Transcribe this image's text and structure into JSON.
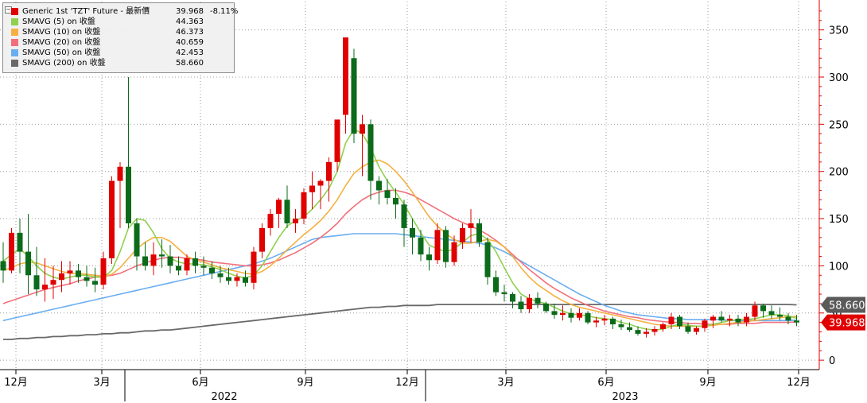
{
  "legend": {
    "rows": [
      {
        "name": "Generic 1st 'TZT' Future - 最新價",
        "value": "39.968",
        "change": "-8.11%",
        "color": "#e00000"
      },
      {
        "name": "SMAVG (5)  on 收盤",
        "value": "44.363",
        "color": "#8fd14f"
      },
      {
        "name": "SMAVG (10)  on 收盤",
        "value": "46.373",
        "color": "#f5b041"
      },
      {
        "name": "SMAVG (20)  on 收盤",
        "value": "40.659",
        "color": "#f1707b"
      },
      {
        "name": "SMAVG (50)  on 收盤",
        "value": "42.453",
        "color": "#6aaef0"
      },
      {
        "name": "SMAVG (200)  on 收盤",
        "value": "58.660",
        "color": "#696969"
      }
    ]
  },
  "chart_data": {
    "type": "candlestick",
    "x_ticks": [
      "12月",
      "3月",
      "6月",
      "9月",
      "12月",
      "3月",
      "6月",
      "9月",
      "12月"
    ],
    "x_groups": [
      "2022",
      "2023"
    ],
    "y_ticks": [
      0,
      50,
      100,
      150,
      200,
      250,
      300,
      350
    ],
    "ylim": [
      -10,
      380
    ],
    "last_price_label": "39.968",
    "sma200_label": "58.660",
    "colors": {
      "up": "#e00000",
      "down": "#0b6b1a",
      "sma5": "#8fd14f",
      "sma10": "#f5b041",
      "sma20": "#f1707b",
      "sma50": "#6aaef0",
      "sma200": "#696969",
      "axis": "#e00000"
    },
    "candles": [
      [
        105,
        125,
        82,
        95
      ],
      [
        95,
        140,
        92,
        135
      ],
      [
        135,
        150,
        92,
        115
      ],
      [
        115,
        155,
        70,
        90
      ],
      [
        90,
        120,
        68,
        75
      ],
      [
        75,
        108,
        62,
        80
      ],
      [
        80,
        100,
        65,
        85
      ],
      [
        85,
        105,
        72,
        92
      ],
      [
        92,
        105,
        80,
        95
      ],
      [
        95,
        102,
        82,
        88
      ],
      [
        88,
        100,
        78,
        84
      ],
      [
        84,
        98,
        72,
        80
      ],
      [
        80,
        115,
        75,
        108
      ],
      [
        108,
        195,
        102,
        190
      ],
      [
        190,
        210,
        140,
        205
      ],
      [
        205,
        300,
        140,
        145
      ],
      [
        145,
        150,
        95,
        110
      ],
      [
        110,
        125,
        95,
        100
      ],
      [
        100,
        125,
        90,
        112
      ],
      [
        112,
        128,
        98,
        110
      ],
      [
        110,
        122,
        92,
        100
      ],
      [
        100,
        110,
        90,
        95
      ],
      [
        95,
        112,
        90,
        108
      ],
      [
        108,
        115,
        92,
        100
      ],
      [
        100,
        110,
        90,
        98
      ],
      [
        98,
        105,
        86,
        92
      ],
      [
        92,
        100,
        82,
        88
      ],
      [
        88,
        98,
        80,
        84
      ],
      [
        84,
        92,
        78,
        88
      ],
      [
        88,
        95,
        78,
        82
      ],
      [
        82,
        120,
        75,
        115
      ],
      [
        115,
        145,
        108,
        140
      ],
      [
        140,
        160,
        132,
        155
      ],
      [
        155,
        172,
        140,
        170
      ],
      [
        170,
        185,
        140,
        145
      ],
      [
        145,
        160,
        135,
        150
      ],
      [
        150,
        182,
        144,
        178
      ],
      [
        178,
        200,
        160,
        185
      ],
      [
        185,
        192,
        160,
        190
      ],
      [
        190,
        215,
        168,
        210
      ],
      [
        210,
        245,
        200,
        255
      ],
      [
        260,
        305,
        240,
        342
      ],
      [
        320,
        330,
        230,
        240
      ],
      [
        240,
        260,
        195,
        250
      ],
      [
        250,
        255,
        170,
        190
      ],
      [
        190,
        195,
        165,
        180
      ],
      [
        180,
        192,
        165,
        172
      ],
      [
        172,
        182,
        150,
        165
      ],
      [
        165,
        170,
        120,
        140
      ],
      [
        140,
        150,
        112,
        130
      ],
      [
        130,
        138,
        105,
        112
      ],
      [
        112,
        120,
        95,
        106
      ],
      [
        106,
        145,
        102,
        138
      ],
      [
        138,
        142,
        98,
        104
      ],
      [
        104,
        132,
        100,
        125
      ],
      [
        125,
        145,
        118,
        140
      ],
      [
        140,
        160,
        125,
        145
      ],
      [
        145,
        150,
        120,
        125
      ],
      [
        125,
        130,
        80,
        88
      ],
      [
        88,
        95,
        68,
        72
      ],
      [
        72,
        80,
        62,
        70
      ],
      [
        70,
        72,
        55,
        62
      ],
      [
        62,
        68,
        50,
        54
      ],
      [
        54,
        70,
        50,
        66
      ],
      [
        66,
        72,
        55,
        60
      ],
      [
        60,
        62,
        50,
        52
      ],
      [
        52,
        60,
        44,
        48
      ],
      [
        48,
        58,
        42,
        50
      ],
      [
        50,
        55,
        40,
        45
      ],
      [
        45,
        55,
        42,
        50
      ],
      [
        50,
        52,
        38,
        40
      ],
      [
        40,
        46,
        35,
        42
      ],
      [
        42,
        48,
        37,
        44
      ],
      [
        44,
        46,
        33,
        38
      ],
      [
        38,
        43,
        32,
        35
      ],
      [
        35,
        40,
        30,
        32
      ],
      [
        32,
        36,
        26,
        28
      ],
      [
        28,
        34,
        24,
        30
      ],
      [
        30,
        36,
        26,
        33
      ],
      [
        33,
        40,
        30,
        38
      ],
      [
        38,
        50,
        33,
        46
      ],
      [
        46,
        48,
        33,
        36
      ],
      [
        36,
        40,
        28,
        30
      ],
      [
        30,
        36,
        27,
        34
      ],
      [
        34,
        44,
        30,
        42
      ],
      [
        42,
        48,
        34,
        46
      ],
      [
        46,
        52,
        40,
        42
      ],
      [
        42,
        48,
        36,
        44
      ],
      [
        44,
        48,
        36,
        40
      ],
      [
        40,
        50,
        36,
        46
      ],
      [
        46,
        62,
        42,
        58
      ],
      [
        58,
        60,
        45,
        52
      ],
      [
        52,
        58,
        44,
        48
      ],
      [
        48,
        56,
        42,
        46
      ],
      [
        46,
        50,
        38,
        42
      ],
      [
        42,
        48,
        36,
        39.968
      ]
    ],
    "sma5": [
      105,
      112,
      118,
      110,
      100,
      92,
      88,
      86,
      88,
      90,
      90,
      88,
      88,
      95,
      115,
      140,
      150,
      148,
      135,
      118,
      108,
      104,
      102,
      102,
      101,
      99,
      96,
      92,
      89,
      87,
      90,
      100,
      115,
      130,
      142,
      148,
      152,
      160,
      170,
      182,
      200,
      230,
      245,
      240,
      225,
      205,
      190,
      178,
      165,
      150,
      135,
      122,
      118,
      115,
      118,
      125,
      132,
      134,
      128,
      115,
      98,
      82,
      70,
      65,
      62,
      60,
      56,
      52,
      49,
      48,
      47,
      45,
      44,
      43,
      40,
      38,
      35,
      33,
      32,
      33,
      36,
      38,
      37,
      36,
      36,
      38,
      40,
      42,
      43,
      43,
      44,
      46,
      48,
      48,
      47,
      44.363
    ],
    "sma10": [
      95,
      98,
      102,
      104,
      103,
      100,
      97,
      94,
      92,
      92,
      91,
      90,
      89,
      91,
      98,
      108,
      118,
      125,
      130,
      130,
      126,
      118,
      110,
      106,
      104,
      101,
      98,
      96,
      94,
      92,
      91,
      94,
      100,
      108,
      117,
      125,
      133,
      140,
      148,
      158,
      170,
      185,
      198,
      205,
      210,
      212,
      208,
      200,
      190,
      178,
      165,
      152,
      142,
      134,
      128,
      124,
      124,
      126,
      128,
      126,
      120,
      110,
      98,
      88,
      80,
      74,
      68,
      63,
      59,
      56,
      54,
      52,
      50,
      48,
      46,
      44,
      42,
      40,
      38,
      37,
      36,
      36,
      36,
      36,
      36,
      37,
      38,
      39,
      40,
      41,
      42,
      43,
      44,
      45,
      46,
      46.373
    ],
    "sma20": [
      60,
      63,
      66,
      69,
      72,
      75,
      77,
      79,
      81,
      84,
      86,
      88,
      89,
      90,
      92,
      96,
      100,
      103,
      106,
      108,
      109,
      109,
      108,
      107,
      106,
      104,
      103,
      102,
      101,
      100,
      100,
      101,
      103,
      106,
      110,
      114,
      119,
      124,
      130,
      137,
      145,
      155,
      163,
      170,
      175,
      178,
      180,
      180,
      178,
      175,
      170,
      165,
      160,
      155,
      150,
      146,
      142,
      138,
      133,
      127,
      120,
      112,
      104,
      96,
      89,
      82,
      76,
      71,
      66,
      62,
      58,
      55,
      52,
      50,
      48,
      46,
      45,
      43,
      42,
      41,
      40,
      40,
      39,
      39,
      38,
      38,
      38,
      38,
      39,
      39,
      39,
      40,
      40,
      40,
      40,
      40.659
    ],
    "sma50": [
      42,
      44,
      46,
      48,
      50,
      52,
      54,
      56,
      58,
      60,
      62,
      64,
      66,
      68,
      70,
      72,
      74,
      76,
      78,
      80,
      82,
      84,
      86,
      88,
      90,
      92,
      94,
      96,
      98,
      100,
      102,
      105,
      108,
      112,
      116,
      120,
      124,
      128,
      130,
      131,
      132,
      133,
      134,
      134,
      134,
      134,
      134,
      134,
      133,
      132,
      131,
      130,
      129,
      128,
      127,
      126,
      125,
      124,
      122,
      119,
      115,
      110,
      105,
      100,
      95,
      90,
      85,
      80,
      75,
      70,
      66,
      62,
      58,
      55,
      52,
      50,
      48,
      47,
      46,
      45,
      44,
      44,
      43,
      43,
      43,
      43,
      43,
      42,
      42,
      42,
      42,
      42,
      42,
      42,
      42,
      42.453
    ],
    "sma200": [
      22,
      22,
      23,
      23,
      24,
      24,
      25,
      25,
      26,
      26,
      27,
      27,
      28,
      28,
      29,
      29,
      30,
      31,
      31,
      32,
      32,
      33,
      34,
      35,
      36,
      37,
      38,
      39,
      40,
      41,
      42,
      43,
      44,
      45,
      46,
      47,
      48,
      49,
      50,
      51,
      52,
      53,
      54,
      55,
      56,
      56,
      57,
      57,
      58,
      58,
      58,
      58,
      59,
      59,
      59,
      59,
      59,
      59,
      59,
      59,
      59,
      59,
      59,
      59,
      59,
      59,
      59,
      59,
      59,
      59,
      59,
      59,
      59,
      59,
      59,
      59,
      59,
      59,
      59,
      59,
      59,
      59,
      59,
      59,
      59,
      59,
      59,
      59,
      59,
      59,
      59,
      59,
      59,
      59,
      59,
      58.66
    ]
  }
}
